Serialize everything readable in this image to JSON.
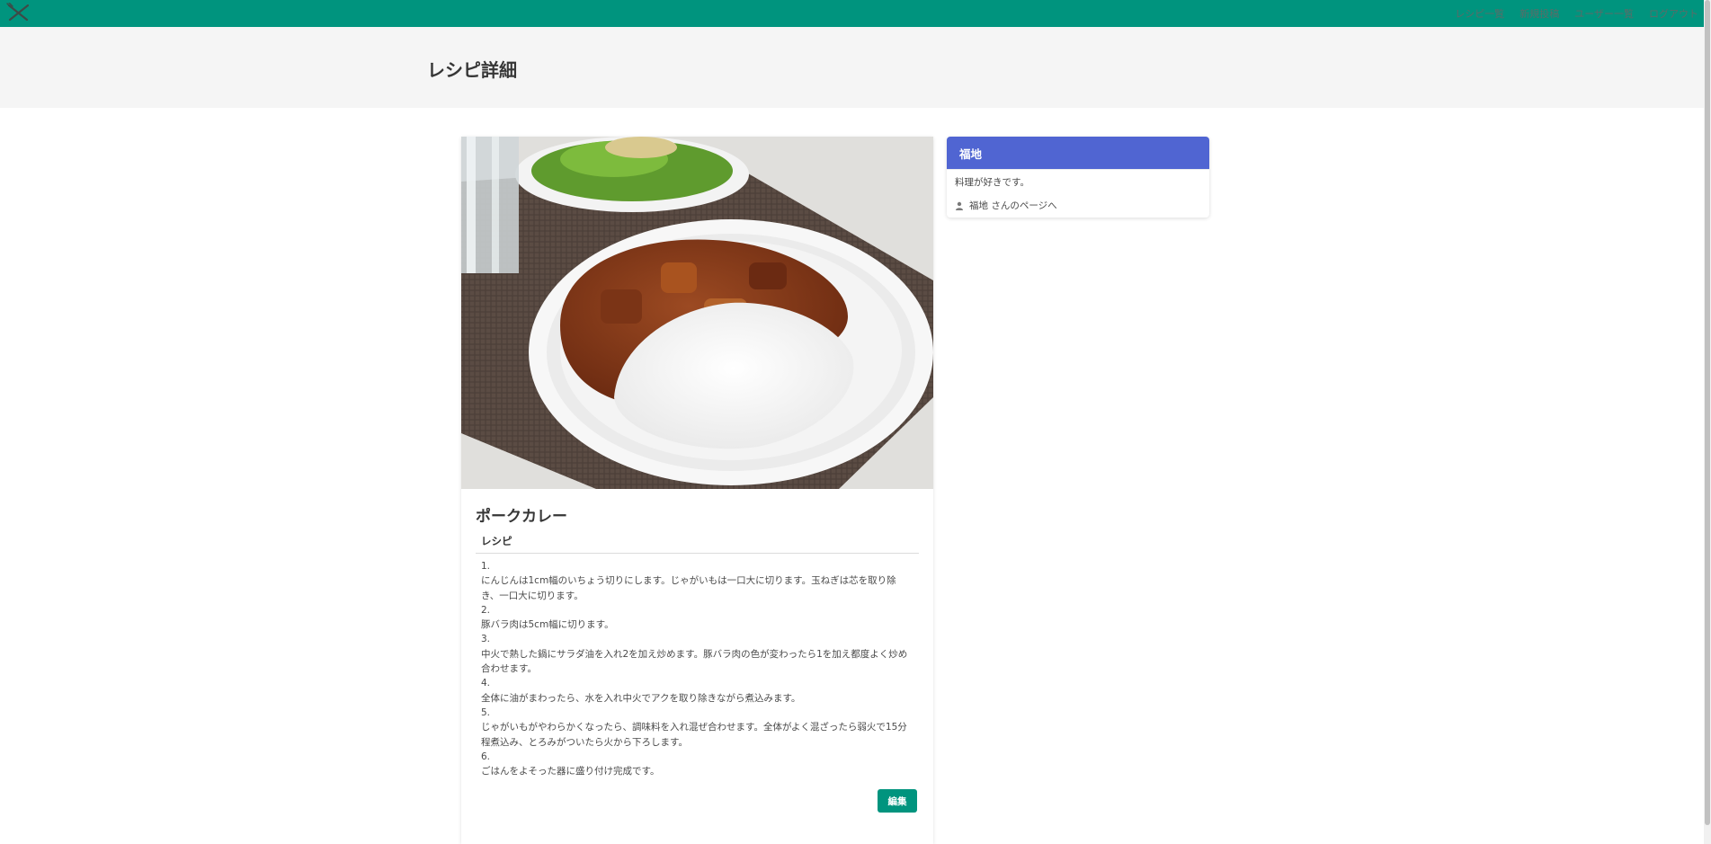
{
  "navbar": {
    "brand_icon": "fork-knife-icon",
    "links": [
      "レシピ一覧",
      "新規投稿",
      "ユーザー一覧",
      "ログアウト"
    ],
    "color": "#00947e"
  },
  "hero": {
    "title": "レシピ詳細"
  },
  "recipe": {
    "title": "ポークカレー",
    "section_label": "レシピ",
    "steps": [
      {
        "num": "1.",
        "text": "にんじんは1cm幅のいちょう切りにします。じゃがいもは一口大に切ります。玉ねぎは芯を取り除き、一口大に切ります。"
      },
      {
        "num": "2.",
        "text": "豚バラ肉は5cm幅に切ります。"
      },
      {
        "num": "3.",
        "text": "中火で熱した鍋にサラダ油を入れ2を加え炒めます。豚バラ肉の色が変わったら1を加え都度よく炒め合わせます。"
      },
      {
        "num": "4.",
        "text": "全体に油がまわったら、水を入れ中火でアクを取り除きながら煮込みます。"
      },
      {
        "num": "5.",
        "text": "じゃがいもがやわらかくなったら、調味料を入れ混ぜ合わせます。全体がよく混ざったら弱火で15分程煮込み、とろみがついたら火から下ろします。"
      },
      {
        "num": "6.",
        "text": "ごはんをよそった器に盛り付け完成です。"
      }
    ],
    "edit_label": "編集"
  },
  "user_panel": {
    "name": "福地",
    "bio": "料理が好きです。",
    "link_label": "福地 さんのページへ",
    "link_icon": "user-icon",
    "heading_color": "#5065d2"
  }
}
